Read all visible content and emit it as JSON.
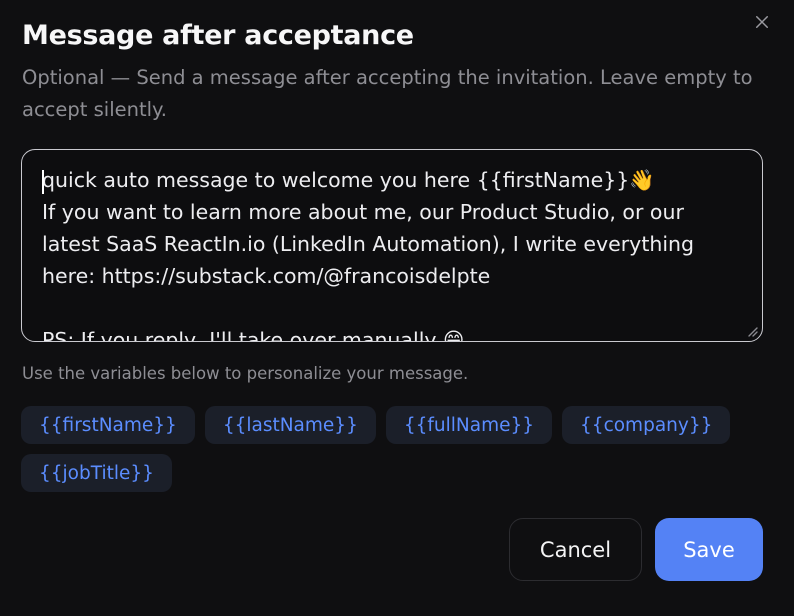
{
  "dialog": {
    "title": "Message after acceptance",
    "subtitle": "Optional — Send a message after accepting the invitation. Leave empty to accept silently.",
    "close_icon": "close-icon"
  },
  "message": {
    "value": "quick auto message to welcome you here {{firstName}}👋\nIf you want to learn more about me, our Product Studio, or our latest SaaS ReactIn.io (LinkedIn Automation), I write everything here: https://substack.com/@francoisdelpte\n\nPS: If you reply, I'll take over manually 😄"
  },
  "variables": {
    "hint": "Use the variables below to personalize your message.",
    "items": [
      {
        "label": "{{firstName}}"
      },
      {
        "label": "{{lastName}}"
      },
      {
        "label": "{{fullName}}"
      },
      {
        "label": "{{company}}"
      },
      {
        "label": "{{jobTitle}}"
      }
    ]
  },
  "actions": {
    "cancel_label": "Cancel",
    "save_label": "Save"
  },
  "colors": {
    "accent": "#5482f5",
    "chip_text": "#5b8dff",
    "background": "#0f0f11"
  }
}
